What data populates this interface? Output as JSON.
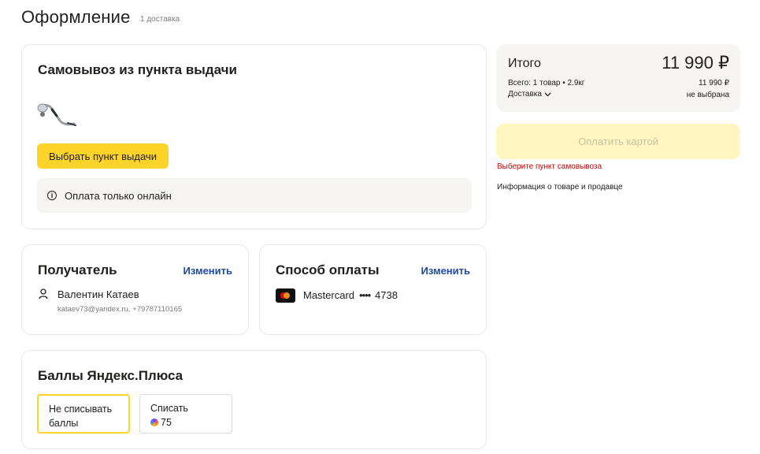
{
  "header": {
    "title": "Оформление",
    "subtitle": "1 доставка"
  },
  "pickup": {
    "title": "Самовывоз из пункта выдачи",
    "product_image": "massager-product-photo",
    "choose_button": "Выбрать пункт выдачи",
    "info_icon": "info-icon",
    "info_text": "Оплата только онлайн"
  },
  "recipient": {
    "title": "Получатель",
    "change_link": "Изменить",
    "name": "Валентин Катаев",
    "contact": "kataev73@yandex.ru, +79787110165"
  },
  "payment": {
    "title": "Способ оплаты",
    "change_link": "Изменить",
    "card_name": "Mastercard",
    "card_dots": "••••",
    "card_last4": "4738"
  },
  "plus_points": {
    "title": "Баллы Яндекс.Плюса",
    "option1": {
      "line1": "Не списывать",
      "line2": "баллы",
      "selected": true
    },
    "option2": {
      "line1": "Списать",
      "amount": "75",
      "selected": false
    }
  },
  "summary": {
    "title": "Итого",
    "total": "11 990 ₽",
    "items_line": "Всего: 1 товар • 2.9кг",
    "items_value": "11 990 ₽",
    "delivery_label": "Доставка",
    "delivery_value": "не выбрана"
  },
  "pay_button": "Оплатить картой",
  "error_text": "Выберите пункт самовывоза",
  "product_info_link": "Информация о товаре и продавце",
  "colors": {
    "accent_yellow": "#fed42b",
    "link_blue": "#1f4aa3",
    "error_red": "#d90000",
    "panel_bg": "#f6f5f3"
  }
}
